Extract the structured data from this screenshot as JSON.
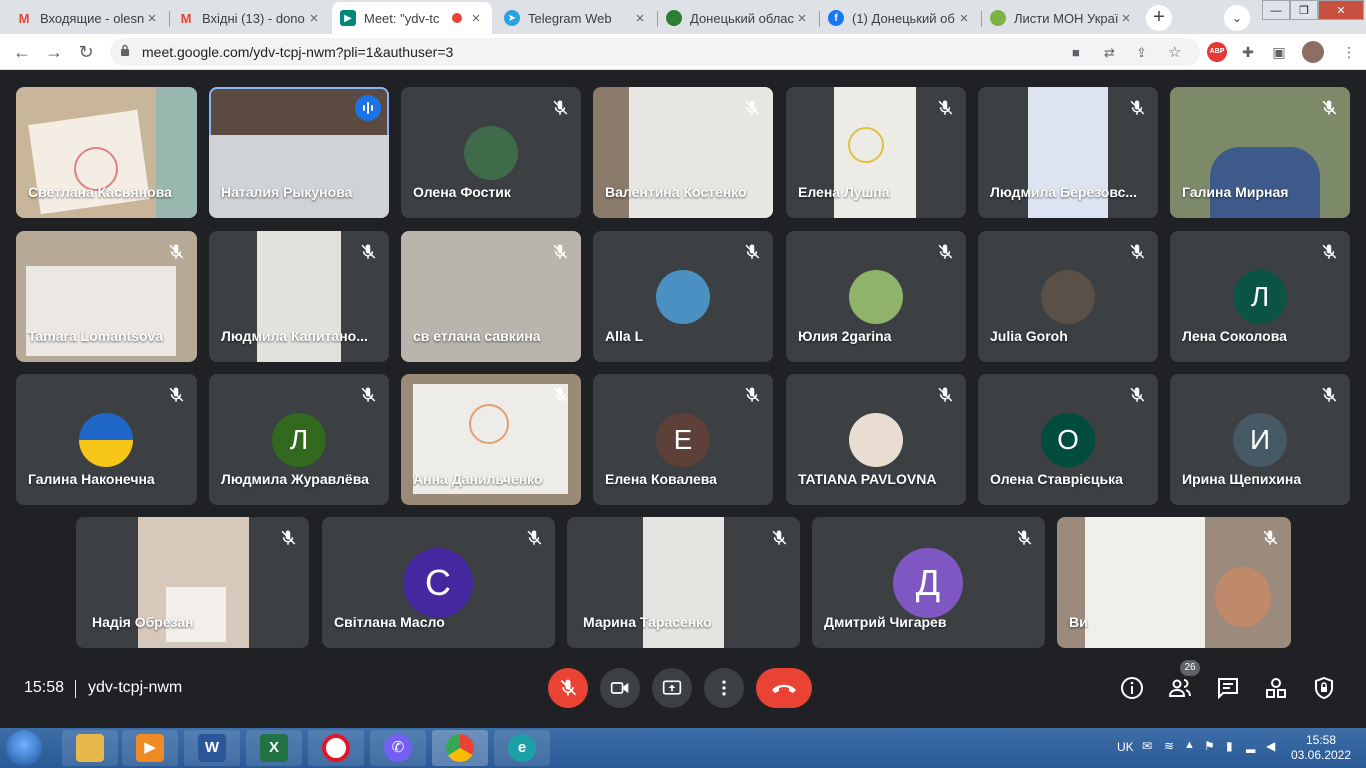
{
  "browser": {
    "tabs": [
      {
        "title": "Входящие - olesn",
        "favicon": "gmail-icon"
      },
      {
        "title": "Вхідні (13) - dono",
        "favicon": "gmail-icon"
      },
      {
        "title": "Meet: \"ydv-tc",
        "favicon": "meet-icon",
        "active": true
      },
      {
        "title": "Telegram Web",
        "favicon": "telegram-icon"
      },
      {
        "title": "Донецький облас",
        "favicon": "site-icon"
      },
      {
        "title": "(1) Донецький об",
        "favicon": "facebook-icon"
      },
      {
        "title": "Листи МОН Украї",
        "favicon": "site-icon"
      }
    ],
    "url": "meet.google.com/ydv-tcpj-nwm?pli=1&authuser=3",
    "abp_label": "ABP"
  },
  "participants": [
    {
      "name": "Светлана Касьянова",
      "type": "video",
      "muted": false
    },
    {
      "name": "Наталия Рыкунова",
      "type": "video",
      "speaking": true
    },
    {
      "name": "Олена Фостик",
      "type": "photo",
      "muted": true
    },
    {
      "name": "Валентина Костенко",
      "type": "video",
      "muted": true
    },
    {
      "name": "Елена Лушпа",
      "type": "video",
      "muted": true
    },
    {
      "name": "Людмила Березовс...",
      "type": "video",
      "muted": true
    },
    {
      "name": "Галина Мирная",
      "type": "video",
      "muted": true
    },
    {
      "name": "Tamara Lomantsova",
      "type": "video",
      "muted": true
    },
    {
      "name": "Людмила Капитано...",
      "type": "video",
      "muted": true
    },
    {
      "name": "св етлана савкина",
      "type": "video",
      "muted": true
    },
    {
      "name": "Alla L",
      "type": "photo",
      "muted": true
    },
    {
      "name": "Юлия 2garina",
      "type": "photo",
      "muted": true
    },
    {
      "name": "Julia Goroh",
      "type": "photo",
      "muted": true
    },
    {
      "name": "Лена Соколова",
      "type": "letter",
      "letter": "Л",
      "color": "#0b5345",
      "muted": true
    },
    {
      "name": "Галина Наконечна",
      "type": "photo",
      "muted": true
    },
    {
      "name": "Людмила Журавлёва",
      "type": "letter",
      "letter": "Л",
      "color": "#33691e",
      "muted": true
    },
    {
      "name": "Анна Данильченко",
      "type": "video",
      "muted": true
    },
    {
      "name": "Елена Ковалева",
      "type": "letter",
      "letter": "Е",
      "color": "#5d4037",
      "muted": true
    },
    {
      "name": "TATIANA PAVLOVNA",
      "type": "photo",
      "muted": true
    },
    {
      "name": "Олена Ставрiєцька",
      "type": "letter",
      "letter": "О",
      "color": "#004d40",
      "muted": true
    },
    {
      "name": "Ирина Щепихина",
      "type": "letter",
      "letter": "И",
      "color": "#455a64",
      "muted": true
    },
    {
      "name": "Надія Обрезан",
      "type": "video",
      "muted": true
    },
    {
      "name": "Світлана Масло",
      "type": "letter",
      "letter": "С",
      "color": "#4527a0",
      "muted": true
    },
    {
      "name": "Марина Тарасенко",
      "type": "video",
      "muted": true
    },
    {
      "name": "Дмитрий Чигарев",
      "type": "letter",
      "letter": "Д",
      "color": "#7e57c2",
      "muted": true
    },
    {
      "name": "Ви",
      "type": "video",
      "muted": true
    }
  ],
  "meeting": {
    "time": "15:58",
    "code": "ydv-tcpj-nwm",
    "people_count": "26"
  },
  "taskbar": {
    "language": "UK",
    "time": "15:58",
    "date": "03.06.2022"
  }
}
